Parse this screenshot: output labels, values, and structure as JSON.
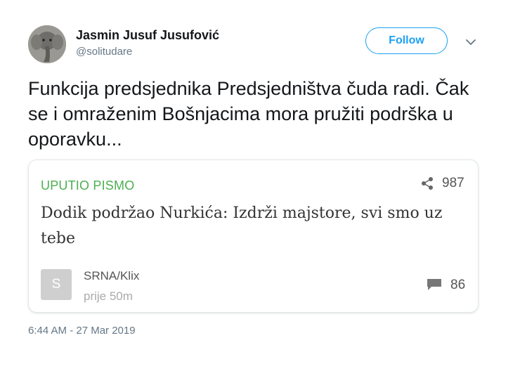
{
  "user": {
    "name": "Jasmin Jusuf Jusufović",
    "handle": "@solitudare",
    "avatar_icon": "elephant-avatar"
  },
  "actions": {
    "follow_label": "Follow",
    "caret_icon": "chevron-down-icon"
  },
  "tweet": {
    "text": "Funkcija predsjednika Predsjedništva čuda radi. Čak se i omraženim Bošnjacima mora pružiti podrška u oporavku...",
    "timestamp": "6:44 AM - 27 Mar 2019"
  },
  "card": {
    "category": "UPUTIO PISMO",
    "share_icon": "share-icon",
    "share_count": "987",
    "title": "Dodik podržao Nurkića: Izdrži majstore, svi smo uz tebe",
    "source_badge": "S",
    "source_name": "SRNA/Klix",
    "source_time": "prije 50m",
    "comment_icon": "comment-icon",
    "comment_count": "86"
  },
  "colors": {
    "accent": "#1da1f2",
    "category": "#4caf50",
    "muted": "#657786"
  }
}
